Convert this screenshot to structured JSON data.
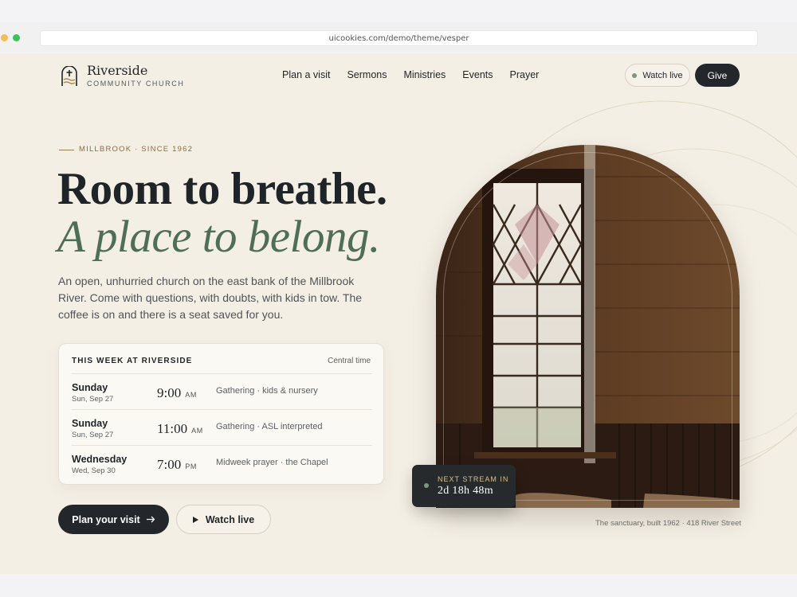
{
  "browser": {
    "url": "uicookies.com/demo/theme/vesper"
  },
  "brand": {
    "name": "Riverside",
    "subtitle": "COMMUNITY CHURCH"
  },
  "nav": {
    "items": [
      "Plan a visit",
      "Sermons",
      "Ministries",
      "Events",
      "Prayer"
    ]
  },
  "header_actions": {
    "watch_live": "Watch live",
    "give": "Give"
  },
  "hero": {
    "eyebrow": "MILLBROOK · SINCE 1962",
    "headline": "Room to breathe.",
    "headline_emphasis": "A place to belong.",
    "lede": "An open, unhurried church on the east bank of the Millbrook River. Come with questions, with doubts, with kids in tow. The coffee is on and there is a seat saved for you."
  },
  "schedule": {
    "title": "THIS WEEK AT RIVERSIDE",
    "timezone": "Central time",
    "rows": [
      {
        "day": "Sunday",
        "date": "Sun, Sep 27",
        "time": "9:00",
        "ampm": "AM",
        "desc": "Gathering · kids & nursery"
      },
      {
        "day": "Sunday",
        "date": "Sun, Sep 27",
        "time": "11:00",
        "ampm": "AM",
        "desc": "Gathering · ASL interpreted"
      },
      {
        "day": "Wednesday",
        "date": "Wed, Sep 30",
        "time": "7:00",
        "ampm": "PM",
        "desc": "Midweek prayer · the Chapel"
      }
    ]
  },
  "cta": {
    "plan": "Plan your visit",
    "plan_icon": "arrow-right-icon",
    "watch": "Watch live",
    "watch_icon": "play-icon"
  },
  "stream": {
    "label": "NEXT STREAM IN",
    "countdown": "2d 18h 48m"
  },
  "image": {
    "caption": "The sanctuary, built 1962 · 418 River Street"
  },
  "colors": {
    "accent_green": "#4f6e56",
    "accent_gold": "#8a6c3f",
    "dark": "#23272b",
    "page_bg": "#f4efe5"
  }
}
